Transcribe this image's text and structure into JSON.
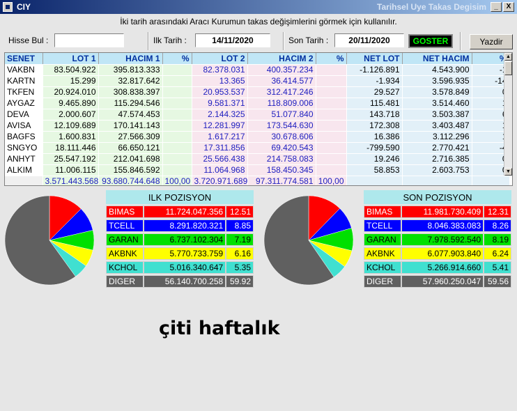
{
  "window": {
    "title": "CIY",
    "subtitle": "Tarihsel Uye Takas Degisim",
    "min_label": "_",
    "close_label": "X"
  },
  "info_text": "İki tarih arasındaki  Aracı Kurumun takas değişimlerini görmek için kullanılır.",
  "search": {
    "label": "Hisse Bul :",
    "value": ""
  },
  "start_date": {
    "label": "Ilk Tarih :",
    "value": "14/11/2020"
  },
  "end_date": {
    "label": "Son Tarih :",
    "value": "20/11/2020"
  },
  "buttons": {
    "goster": "GOSTER",
    "yazdir": "Yazdir"
  },
  "grid": {
    "columns": [
      "SENET",
      "LOT 1",
      "HACIM 1",
      "%",
      "LOT 2",
      "HACIM 2",
      "%",
      "NET LOT",
      "NET HACIM",
      "%"
    ],
    "rows": [
      [
        "VAKBN",
        "83.504.922",
        "395.813.333",
        "",
        "82.378.031",
        "400.357.234",
        "",
        "-1.126.891",
        "4.543.900",
        "-1"
      ],
      [
        "KARTN",
        "15.299",
        "32.817.642",
        "",
        "13.365",
        "36.414.577",
        "",
        "-1.934",
        "3.596.935",
        "-14"
      ],
      [
        "TKFEN",
        "20.924.010",
        "308.838.397",
        "",
        "20.953.537",
        "312.417.246",
        "",
        "29.527",
        "3.578.849",
        "0"
      ],
      [
        "AYGAZ",
        "9.465.890",
        "115.294.546",
        "",
        "9.581.371",
        "118.809.006",
        "",
        "115.481",
        "3.514.460",
        "1"
      ],
      [
        "DEVA",
        "2.000.607",
        "47.574.453",
        "",
        "2.144.325",
        "51.077.840",
        "",
        "143.718",
        "3.503.387",
        "6"
      ],
      [
        "AVISA",
        "12.109.689",
        "170.141.143",
        "",
        "12.281.997",
        "173.544.630",
        "",
        "172.308",
        "3.403.487",
        "1"
      ],
      [
        "BAGFS",
        "1.600.831",
        "27.566.309",
        "",
        "1.617.217",
        "30.678.606",
        "",
        "16.386",
        "3.112.296",
        "1"
      ],
      [
        "SNGYO",
        "18.111.446",
        "66.650.121",
        "",
        "17.311.856",
        "69.420.543",
        "",
        "-799.590",
        "2.770.421",
        "-4"
      ],
      [
        "ANHYT",
        "25.547.192",
        "212.041.698",
        "",
        "25.566.438",
        "214.758.083",
        "",
        "19.246",
        "2.716.385",
        "0"
      ],
      [
        "ALKIM",
        "11.006.115",
        "155.846.592",
        "",
        "11.064.968",
        "158.450.345",
        "",
        "58.853",
        "2.603.753",
        "0"
      ]
    ],
    "totals": [
      "",
      "3.571.443.568",
      "93.680.744.648",
      "100,00",
      "3.720.971.689",
      "97.311.774.581",
      "100,00",
      "",
      "",
      ""
    ]
  },
  "ilk_pozisyon": {
    "title": "ILK POZISYON",
    "rows": [
      {
        "name": "BIMAS",
        "value": "11.724.047.356",
        "pct": "12.51",
        "pct_num": 12.51,
        "color": "#ff0000",
        "text": "#ffffff"
      },
      {
        "name": "TCELL",
        "value": "8.291.820.321",
        "pct": "8.85",
        "pct_num": 8.85,
        "color": "#0000ff",
        "text": "#ffffff"
      },
      {
        "name": "GARAN",
        "value": "6.737.102.304",
        "pct": "7.19",
        "pct_num": 7.19,
        "color": "#00e000",
        "text": "#000000"
      },
      {
        "name": "AKBNK",
        "value": "5.770.733.759",
        "pct": "6.16",
        "pct_num": 6.16,
        "color": "#ffff00",
        "text": "#000000"
      },
      {
        "name": "KCHOL",
        "value": "5.016.340.647",
        "pct": "5.35",
        "pct_num": 5.35,
        "color": "#40e0d0",
        "text": "#000000"
      },
      {
        "name": "DIGER",
        "value": "56.140.700.258",
        "pct": "59.92",
        "pct_num": 59.92,
        "color": "#606060",
        "text": "#ffffff"
      }
    ]
  },
  "son_pozisyon": {
    "title": "SON POZISYON",
    "rows": [
      {
        "name": "BIMAS",
        "value": "11.981.730.409",
        "pct": "12.31",
        "pct_num": 12.31,
        "color": "#ff0000",
        "text": "#ffffff"
      },
      {
        "name": "TCELL",
        "value": "8.046.383.083",
        "pct": "8.26",
        "pct_num": 8.26,
        "color": "#0000ff",
        "text": "#ffffff"
      },
      {
        "name": "GARAN",
        "value": "7.978.592.540",
        "pct": "8.19",
        "pct_num": 8.19,
        "color": "#00e000",
        "text": "#000000"
      },
      {
        "name": "AKBNK",
        "value": "6.077.903.840",
        "pct": "6.24",
        "pct_num": 6.24,
        "color": "#ffff00",
        "text": "#000000"
      },
      {
        "name": "KCHOL",
        "value": "5.266.914.660",
        "pct": "5.41",
        "pct_num": 5.41,
        "color": "#40e0d0",
        "text": "#000000"
      },
      {
        "name": "DIGER",
        "value": "57.960.250.047",
        "pct": "59.56",
        "pct_num": 59.56,
        "color": "#606060",
        "text": "#ffffff"
      }
    ]
  },
  "caption": "çiti haftalık"
}
